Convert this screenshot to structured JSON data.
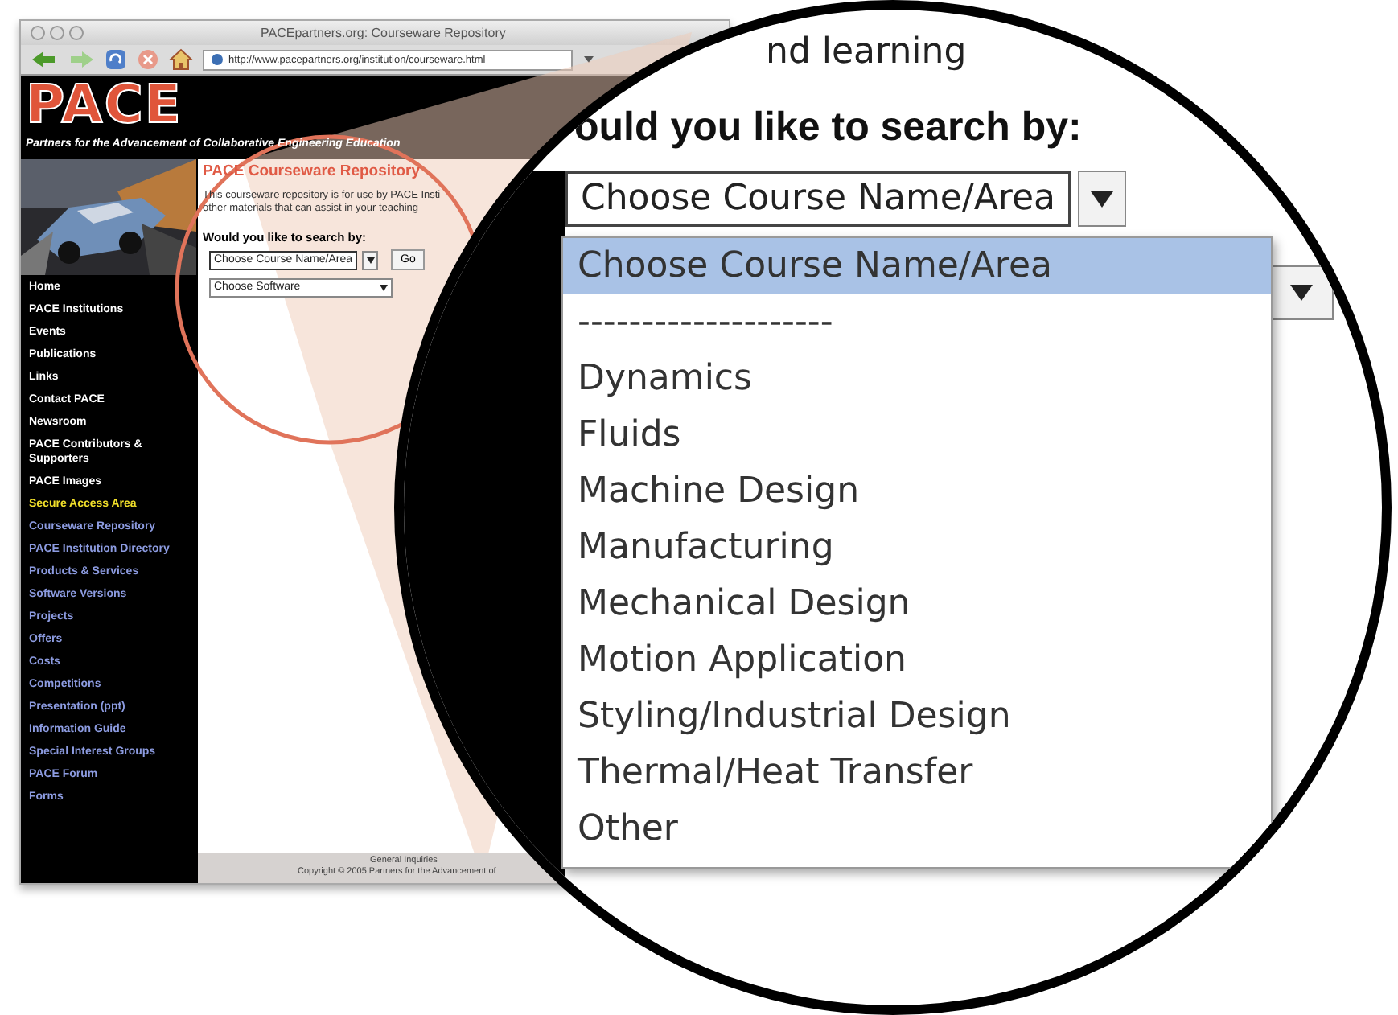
{
  "browser": {
    "title": "PACEpartners.org: Courseware Repository",
    "url": "http://www.pacepartners.org/institution/courseware.html"
  },
  "site": {
    "logo": "PACE",
    "tagline": "Partners for the Advancement of Collaborative Engineering Education",
    "nav": [
      {
        "label": "Home",
        "color": "#ffffff"
      },
      {
        "label": "PACE Institutions",
        "color": "#ffffff"
      },
      {
        "label": "Events",
        "color": "#ffffff"
      },
      {
        "label": "Publications",
        "color": "#ffffff"
      },
      {
        "label": "Links",
        "color": "#ffffff"
      },
      {
        "label": "Contact PACE",
        "color": "#ffffff"
      },
      {
        "label": "Newsroom",
        "color": "#ffffff"
      },
      {
        "label": "PACE Contributors & Supporters",
        "color": "#ffffff"
      },
      {
        "label": "PACE Images",
        "color": "#ffffff"
      },
      {
        "label": "Secure Access Area",
        "color": "#f2e02a"
      },
      {
        "label": "Courseware Repository",
        "color": "#8c9be0"
      },
      {
        "label": "PACE Institution Directory",
        "color": "#8c9be0"
      },
      {
        "label": "Products & Services",
        "color": "#8c9be0"
      },
      {
        "label": "Software Versions",
        "color": "#8c9be0"
      },
      {
        "label": "Projects",
        "color": "#8c9be0"
      },
      {
        "label": "Offers",
        "color": "#8c9be0"
      },
      {
        "label": "Costs",
        "color": "#8c9be0"
      },
      {
        "label": "Competitions",
        "color": "#8c9be0"
      },
      {
        "label": "Presentation (ppt)",
        "color": "#8c9be0"
      },
      {
        "label": "Information Guide",
        "color": "#8c9be0"
      },
      {
        "label": "Special Interest Groups",
        "color": "#8c9be0"
      },
      {
        "label": "PACE Forum",
        "color": "#8c9be0"
      },
      {
        "label": "Forms",
        "color": "#8c9be0"
      }
    ],
    "heading": "PACE Courseware Repository",
    "intro": [
      "This courseware repository is for use by PACE Insti",
      "other materials that can assist in your teaching"
    ],
    "search_label": "Would you like to search by:",
    "course_select": "Choose Course Name/Area",
    "go_button": "Go",
    "software_select": "Choose Software",
    "footer": [
      "General Inquiries",
      "Copyright © 2005 Partners for the Advancement of"
    ]
  },
  "magnifier": {
    "caption": "nd learning",
    "search_label": "ould you like to search by:",
    "course_select": "Choose Course Name/Area",
    "options": [
      {
        "label": "Choose Course Name/Area",
        "selected": true
      },
      {
        "label": "--------------------",
        "selected": false
      },
      {
        "label": "Dynamics",
        "selected": false
      },
      {
        "label": "Fluids",
        "selected": false
      },
      {
        "label": "Machine Design",
        "selected": false
      },
      {
        "label": "Manufacturing",
        "selected": false
      },
      {
        "label": "Mechanical Design",
        "selected": false
      },
      {
        "label": "Motion Application",
        "selected": false
      },
      {
        "label": "Styling/Industrial Design",
        "selected": false
      },
      {
        "label": "Thermal/Heat Transfer",
        "selected": false
      },
      {
        "label": "Other",
        "selected": false
      }
    ]
  }
}
